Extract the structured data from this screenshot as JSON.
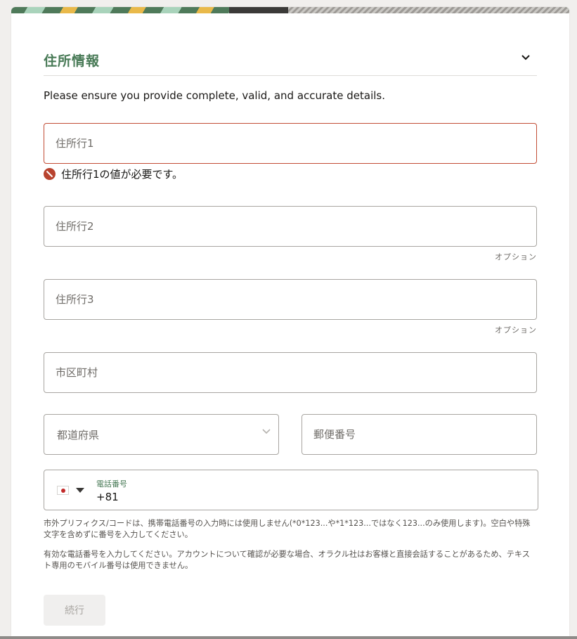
{
  "section": {
    "title": "住所情報",
    "collapse_icon": "chevron-down-icon"
  },
  "intro_text": "Please ensure you provide complete, valid, and accurate details.",
  "fields": {
    "address1": {
      "placeholder": "住所行1",
      "value": ""
    },
    "address1_error": "住所行1の値が必要です。",
    "address2": {
      "placeholder": "住所行2",
      "value": ""
    },
    "address2_optional": "オプション",
    "address3": {
      "placeholder": "住所行3",
      "value": ""
    },
    "address3_optional": "オプション",
    "city": {
      "placeholder": "市区町村",
      "value": ""
    },
    "prefecture": {
      "placeholder": "都道府県"
    },
    "postal_code": {
      "placeholder": "郵便番号",
      "value": ""
    },
    "phone": {
      "label": "電話番号",
      "value": "+81",
      "country_icon": "japan-flag-icon"
    }
  },
  "help": {
    "phone_prefix_note": "市外プリフィクス/コードは、携帯電話番号の入力時には使用しません(*0*123...や*1*123...ではなく123...のみ使用します)。空白や特殊文字を含めずに番号を入力してください。",
    "phone_valid_note": "有効な電話番号を入力してください。アカウントについて確認が必要な場合、オラクル社はお客様と直接会話することがあるため、テキスト専用のモバイル番号は使用できません。"
  },
  "buttons": {
    "continue_label": "続行"
  },
  "colors": {
    "accent": "#487a56",
    "error": "#c24c35",
    "border": "#a8a5a1"
  }
}
